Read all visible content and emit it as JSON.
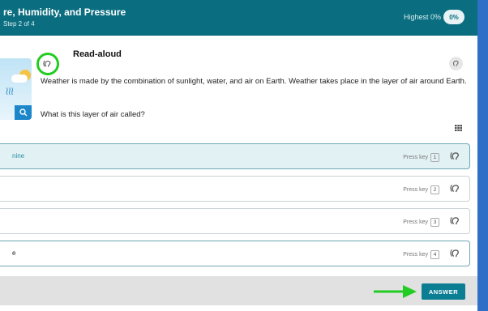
{
  "header": {
    "title": "re, Humidity, and Pressure",
    "step": "Step 2 of 4",
    "highest_label": "Highest 0%",
    "score_pill": "0%"
  },
  "readaloud": {
    "label": "Read-aloud"
  },
  "content": {
    "passage": "Weather is made by the combination of sunlight, water, and air on Earth. Weather takes place in the layer of air around Earth.",
    "question": "What is this layer of air called?"
  },
  "options": [
    {
      "text": "nine",
      "press_label": "Press key",
      "key": "1"
    },
    {
      "text": "",
      "press_label": "Press key",
      "key": "2"
    },
    {
      "text": "",
      "press_label": "Press key",
      "key": "3"
    },
    {
      "text": "e",
      "press_label": "Press key",
      "key": "4"
    }
  ],
  "footer": {
    "answer_label": "ANSWER"
  },
  "icons": {
    "readaloud": "ear-icon",
    "settings": "ear-settings-icon",
    "grid": "grid-icon",
    "zoom": "zoom-icon"
  },
  "colors": {
    "header": "#0b6e80",
    "highlight_circle": "#22cc22",
    "arrow": "#22cc22",
    "answer_button": "#0b7e93",
    "frame": "#2f6fc8"
  }
}
